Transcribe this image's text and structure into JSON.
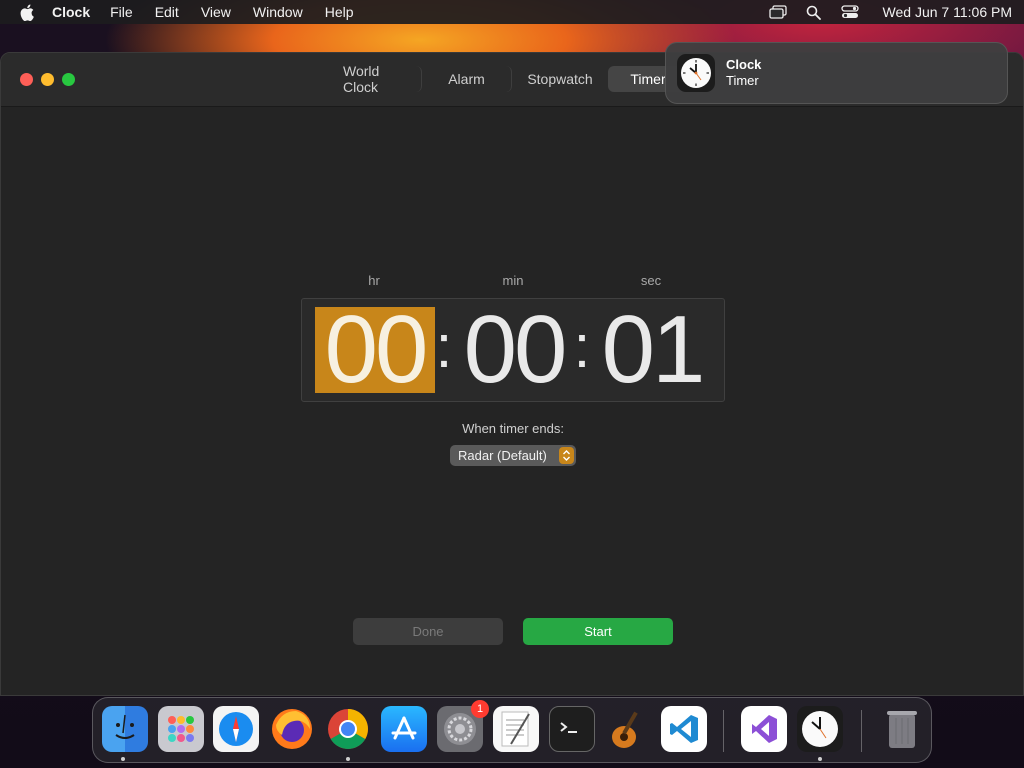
{
  "menubar": {
    "app_name": "Clock",
    "items": [
      "File",
      "Edit",
      "View",
      "Window",
      "Help"
    ],
    "datetime": "Wed Jun 7  11:06 PM"
  },
  "window": {
    "tabs": [
      "World Clock",
      "Alarm",
      "Stopwatch",
      "Timer"
    ],
    "active_tab": "Timer"
  },
  "timer": {
    "unit_labels": {
      "hr": "hr",
      "min": "min",
      "sec": "sec"
    },
    "hours": "00",
    "minutes": "00",
    "seconds": "01",
    "separator": ":",
    "selected_field": "hr",
    "ends_label": "When timer ends:",
    "sound": "Radar (Default)"
  },
  "buttons": {
    "done": "Done",
    "start": "Start"
  },
  "notification": {
    "title": "Clock",
    "body": "Timer"
  },
  "dock": {
    "apps": [
      {
        "name": "Finder",
        "running": true
      },
      {
        "name": "Launchpad",
        "running": false
      },
      {
        "name": "Safari",
        "running": false
      },
      {
        "name": "Firefox",
        "running": false
      },
      {
        "name": "Google Chrome",
        "running": true
      },
      {
        "name": "App Store",
        "running": false
      },
      {
        "name": "System Settings",
        "running": false,
        "badge": "1"
      },
      {
        "name": "TextEdit",
        "running": false
      },
      {
        "name": "Terminal",
        "running": false
      },
      {
        "name": "GarageBand",
        "running": false
      },
      {
        "name": "Visual Studio Code",
        "running": false
      },
      {
        "name": "Visual Studio",
        "running": false
      },
      {
        "name": "Clock",
        "running": true
      },
      {
        "name": "Trash",
        "running": false
      }
    ]
  },
  "colors": {
    "accent": "#c8861a",
    "start_green": "#27a844",
    "window_bg": "#242424"
  }
}
